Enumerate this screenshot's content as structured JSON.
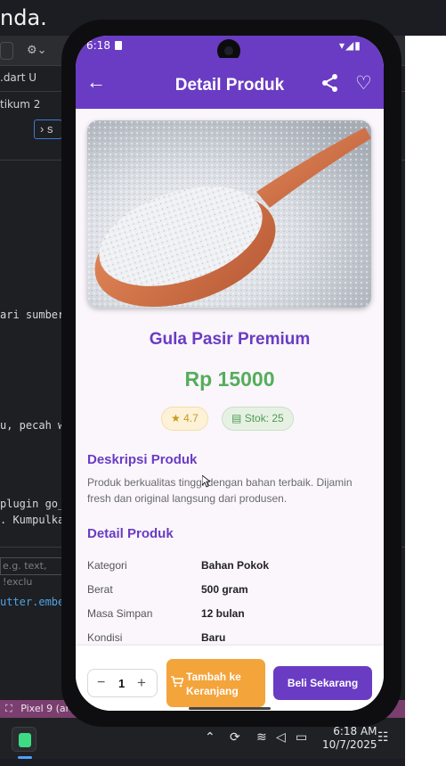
{
  "caption": "nda.",
  "ide": {
    "tab_file": ".dart U",
    "tab_praktikum": "tikum 2",
    "chevron_label": "s",
    "code_line_1": "ari sumber",
    "code_line_2": "u, pecah w",
    "code_line_3": "plugin go_",
    "code_line_4": ". Kumpulka",
    "search_placeholder": "e.g. text, !exclu",
    "embed_line": "utter.embe",
    "status_device": "Pixel 9 (and"
  },
  "taskbar": {
    "time": "6:18 AM",
    "date": "10/7/2025"
  },
  "phone": {
    "status_time": "6:18",
    "appbar_title": "Detail Produk",
    "product_name": "Gula Pasir Premium",
    "price": "Rp 15000",
    "rating": "4.7",
    "stock": "Stok: 25",
    "description_heading": "Deskripsi Produk",
    "description": "Produk berkualitas tinggi dengan bahan terbaik. Dijamin fresh dan original langsung dari produsen.",
    "details_heading": "Detail Produk",
    "details": [
      {
        "label": "Kategori",
        "value": "Bahan Pokok"
      },
      {
        "label": "Berat",
        "value": "500 gram"
      },
      {
        "label": "Masa Simpan",
        "value": "12 bulan"
      },
      {
        "label": "Kondisi",
        "value": "Baru"
      }
    ],
    "quantity": "1",
    "add_to_cart_label": "Tambah ke Keranjang",
    "buy_now_label": "Beli Sekarang"
  },
  "colors": {
    "primary": "#6a3cc3",
    "price_green": "#55ad5c",
    "cart_orange": "#f3a43b",
    "rating_gold": "#c79a22"
  },
  "icons": [
    "back-arrow-icon",
    "share-icon",
    "heart-icon",
    "star-icon",
    "stock-icon",
    "cart-icon",
    "minus-icon",
    "plus-icon"
  ]
}
